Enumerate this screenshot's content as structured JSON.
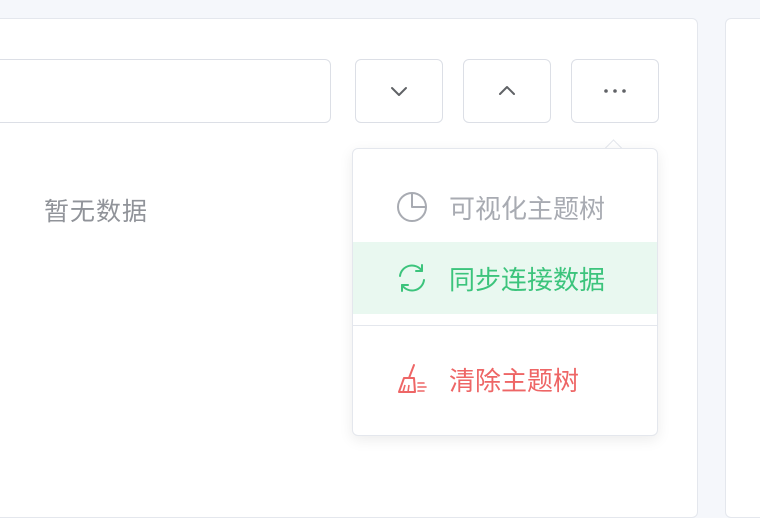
{
  "search": {
    "value": "",
    "placeholder": ""
  },
  "toolbar": {
    "down_icon": "chevron-down-icon",
    "up_icon": "chevron-up-icon",
    "more_label": "···"
  },
  "tree": {
    "empty_text": "暂无数据"
  },
  "menu": {
    "items": [
      {
        "label": "可视化主题树",
        "icon": "pie-chart-icon",
        "state": "disabled",
        "color": "#a8abb2"
      },
      {
        "label": "同步连接数据",
        "icon": "refresh-icon",
        "state": "hovered",
        "color": "#3cc47c"
      },
      {
        "label": "清除主题树",
        "icon": "broom-icon",
        "state": "danger",
        "color": "#ee6666"
      }
    ]
  },
  "colors": {
    "success": "#3cc47c",
    "success_bg": "#e9f8f0",
    "danger": "#ee6666",
    "muted": "#a8abb2",
    "border": "#dcdfe6"
  }
}
